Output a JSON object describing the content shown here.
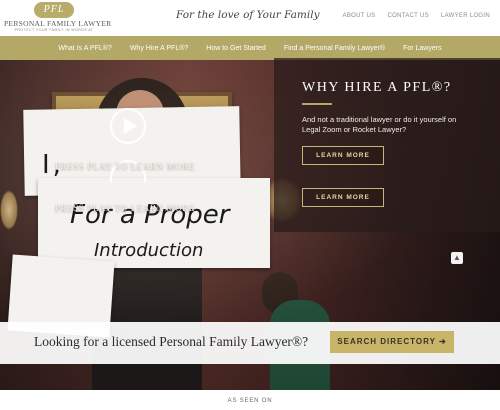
{
  "header": {
    "logo_badge": "PFL",
    "logo_name": "PERSONAL FAMILY LAWYER",
    "logo_tagline": "PROTECT YOUR FAMILY IN WORDS AT",
    "tagline": "For the love of Your Family",
    "util_nav": [
      "ABOUT US",
      "CONTACT US",
      "LAWYER LOGIN"
    ]
  },
  "nav": {
    "items": [
      "What Is A PFL®?",
      "Why Hire A PFL®?",
      "How to Get Started",
      "Find a Personal Family Lawyer®",
      "For Lawyers"
    ]
  },
  "hero": {
    "sign1_text": "I,",
    "sign2_text": "For a Proper",
    "sign3_text": "Introduction",
    "press_play_1": "PRESS PLAY TO LEARN MORE",
    "press_play_2": "PRESS PLAY TO LEARN MORE",
    "panel_title": "WHY HIRE A PFL®?",
    "panel_sub": "And not a traditional lawyer or do it yourself on Legal Zoom or Rocket Lawyer?",
    "learn_more_1": "LEARN MORE",
    "learn_more_2": "LEARN MORE"
  },
  "search": {
    "prompt": "Looking for a licensed Personal Family Lawyer®?",
    "button": "SEARCH DIRECTORY ➔"
  },
  "footer": {
    "as_seen_on": "AS SEEN ON"
  },
  "colors": {
    "accent": "#b4a866",
    "button_gold": "#c8b56a",
    "hero_bg": "#55302c"
  },
  "icons": {
    "play": "play-icon",
    "scroll_up": "chevron-up-icon"
  }
}
